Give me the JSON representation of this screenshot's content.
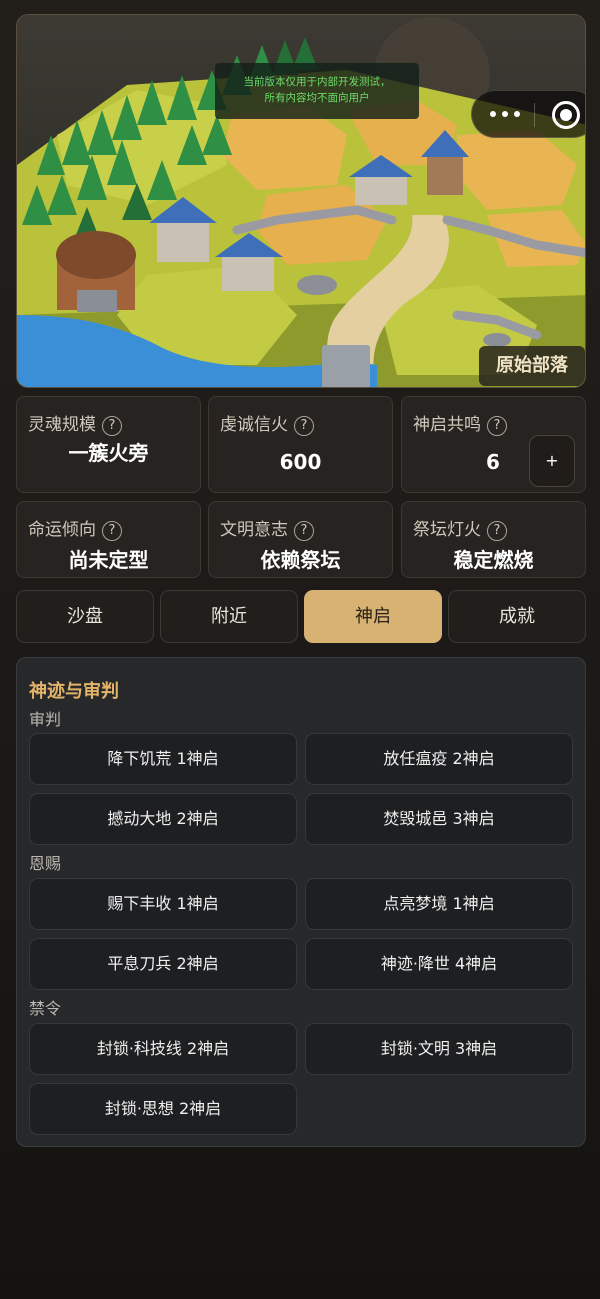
{
  "scene": {
    "notice_line1": "当前版本仅用于内部开发测试，",
    "notice_line2": "所有内容均不面向用户",
    "stage": "原始部落"
  },
  "stats": [
    {
      "label": "灵魂规模",
      "value": "一簇火旁"
    },
    {
      "label": "虔诚信火",
      "value": "600"
    },
    {
      "label": "神启共鸣",
      "value": "6",
      "action": "+"
    },
    {
      "label": "命运倾向",
      "value": "尚未定型"
    },
    {
      "label": "文明意志",
      "value": "依赖祭坛"
    },
    {
      "label": "祭坛灯火",
      "value": "稳定燃烧"
    }
  ],
  "help_glyph": "?",
  "tabs": [
    "沙盘",
    "附近",
    "神启",
    "成就"
  ],
  "active_tab": "神启",
  "panel": {
    "title": "神迹与审判",
    "groups": [
      {
        "label": "审判",
        "items": [
          "降下饥荒 1神启",
          "放任瘟疫 2神启",
          "撼动大地 2神启",
          "焚毁城邑 3神启"
        ]
      },
      {
        "label": "恩赐",
        "items": [
          "赐下丰收 1神启",
          "点亮梦境 1神启",
          "平息刀兵 2神启",
          "神迹·降世 4神启"
        ]
      },
      {
        "label": "禁令",
        "items": [
          "封锁·科技线 2神启",
          "封锁·文明 3神启",
          "封锁·思想 2神启"
        ]
      }
    ]
  },
  "colors": {
    "accent": "#d7b272",
    "title_gold": "#e3b36a",
    "notice_green": "#6fdc6a"
  },
  "icons": {
    "menu": "more-dots-icon",
    "close": "target-circle-icon",
    "help": "question-circle-icon"
  }
}
